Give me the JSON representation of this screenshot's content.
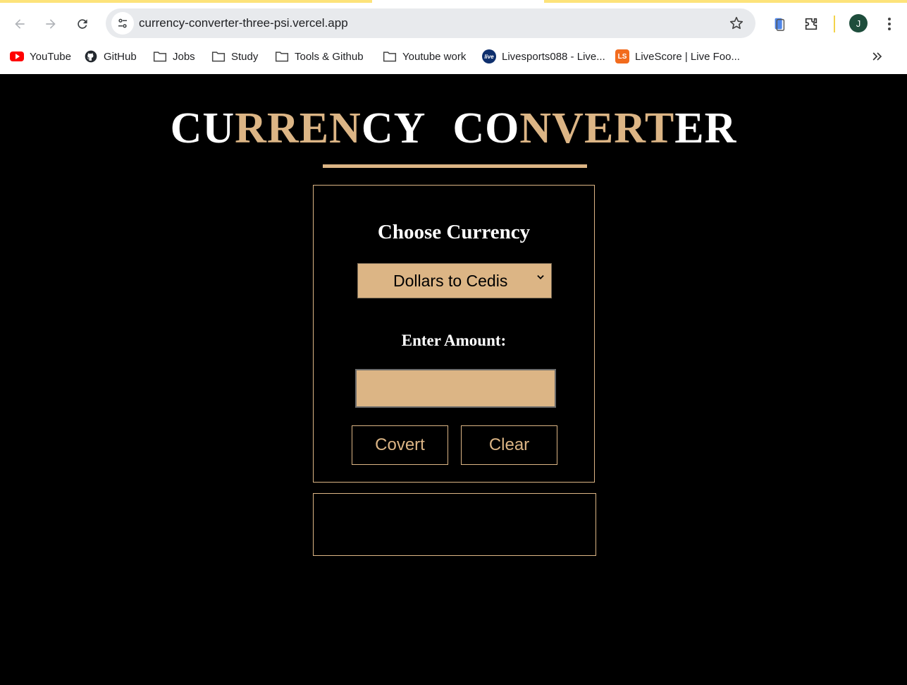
{
  "browser": {
    "url": "currency-converter-three-psi.vercel.app",
    "profile_initial": "J",
    "bookmarks": [
      {
        "label": "YouTube",
        "icon": "youtube-icon"
      },
      {
        "label": "GitHub",
        "icon": "github-icon"
      },
      {
        "label": "Jobs",
        "icon": "folder-icon"
      },
      {
        "label": "Study",
        "icon": "folder-icon"
      },
      {
        "label": "Tools & Github",
        "icon": "folder-icon"
      },
      {
        "label": "Youtube work",
        "icon": "folder-icon"
      },
      {
        "label": "Livesports088 - Live...",
        "icon": "livesports-icon"
      },
      {
        "label": "LiveScore | Live Foo...",
        "icon": "livescore-icon"
      }
    ],
    "livesports_icon_text": "live",
    "livescore_icon_text": "LS"
  },
  "app": {
    "title_word1_parts": [
      "CU",
      "RREN",
      "CY"
    ],
    "title_word2_parts": [
      "CO",
      "NVERT",
      "ER"
    ],
    "choose_label": "Choose Currency",
    "select_value": "Dollars to Cedis",
    "amount_label": "Enter Amount:",
    "amount_value": "",
    "convert_button": "Covert",
    "clear_button": "Clear",
    "result_text": ""
  },
  "colors": {
    "accent": "#dcb585",
    "background": "#000000",
    "title_white": "#ffffff"
  }
}
